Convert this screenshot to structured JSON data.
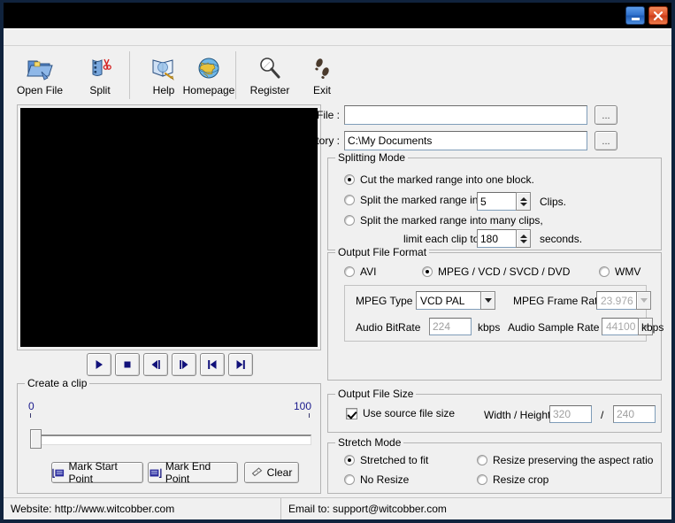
{
  "window": {
    "title": "",
    "minimize_label": "_",
    "close_label": "✕"
  },
  "toolbar": {
    "items": [
      {
        "label": "Open File",
        "icon": "open-folder-icon"
      },
      {
        "label": "Split",
        "icon": "film-scissors-icon"
      },
      {
        "label": "Help",
        "icon": "book-pen-icon"
      },
      {
        "label": "Homepage",
        "icon": "globe-icon"
      },
      {
        "label": "Register",
        "icon": "magnifier-key-icon"
      },
      {
        "label": "Exit",
        "icon": "footprints-icon"
      }
    ]
  },
  "preview": {
    "screen_color": "#000000"
  },
  "playback": {
    "buttons": [
      {
        "name": "play-button",
        "icon": "play-icon"
      },
      {
        "name": "stop-button",
        "icon": "stop-icon"
      },
      {
        "name": "step-back-button",
        "icon": "step-backward-icon"
      },
      {
        "name": "step-forward-button",
        "icon": "step-forward-icon"
      },
      {
        "name": "skip-start-button",
        "icon": "skip-to-start-icon"
      },
      {
        "name": "skip-end-button",
        "icon": "skip-to-end-icon"
      }
    ]
  },
  "create_clip": {
    "title": "Create a clip",
    "scale_min": "0",
    "scale_max": "100",
    "slider_value": 0,
    "buttons": {
      "mark_start": "Mark Start Point",
      "mark_end": "Mark End Point",
      "clear": "Clear"
    }
  },
  "source": {
    "source_file_label": "Source File :",
    "source_file_value": "",
    "source_file_browse": "...",
    "save_directory_label": "Save Directory :",
    "save_directory_value": "C:\\My Documents",
    "save_directory_browse": "..."
  },
  "splitting_mode": {
    "title": "Splitting Mode",
    "options": [
      {
        "label": "Cut the marked range into one block.",
        "selected": true
      },
      {
        "label": "Split the marked range into",
        "selected": false
      },
      {
        "label": "Split the marked range into many clips,",
        "selected": false
      }
    ],
    "clips_value": "5",
    "clips_suffix": "Clips.",
    "limit_label": "limit each clip to",
    "limit_value": "180",
    "limit_suffix": "seconds."
  },
  "output_format": {
    "title": "Output File Format",
    "options": [
      {
        "label": "AVI",
        "selected": false
      },
      {
        "label": "MPEG / VCD / SVCD / DVD",
        "selected": true
      },
      {
        "label": "WMV",
        "selected": false
      }
    ],
    "mpeg_type_label": "MPEG Type",
    "mpeg_type_value": "VCD PAL",
    "frame_rate_label": "MPEG Frame Rate",
    "frame_rate_value": "23.976",
    "audio_bitrate_label": "Audio BitRate",
    "audio_bitrate_value": "224",
    "audio_bitrate_unit": "kbps",
    "audio_sample_label": "Audio Sample Rate",
    "audio_sample_value": "44100",
    "audio_sample_unit": "kbps"
  },
  "output_size": {
    "title": "Output File Size",
    "use_source_label": "Use source file size",
    "use_source_checked": true,
    "wh_label": "Width / Height",
    "width_value": "320",
    "separator": "/",
    "height_value": "240"
  },
  "stretch_mode": {
    "title": "Stretch Mode",
    "options": [
      {
        "label": "Stretched to fit",
        "selected": true
      },
      {
        "label": "Resize preserving the aspect ratio",
        "selected": false
      },
      {
        "label": "No Resize",
        "selected": false
      },
      {
        "label": "Resize crop",
        "selected": false
      }
    ]
  },
  "statusbar": {
    "website": "Website: http://www.witcobber.com",
    "email": "Email to: support@witcobber.com"
  },
  "colors": {
    "window_frame": "#10233d",
    "titlebar": "#000000",
    "client_bg": "#f0f0f0",
    "accent_navy": "#1a1a8c",
    "close_button": "#e0502a",
    "minimize_button": "#2f72cd"
  }
}
